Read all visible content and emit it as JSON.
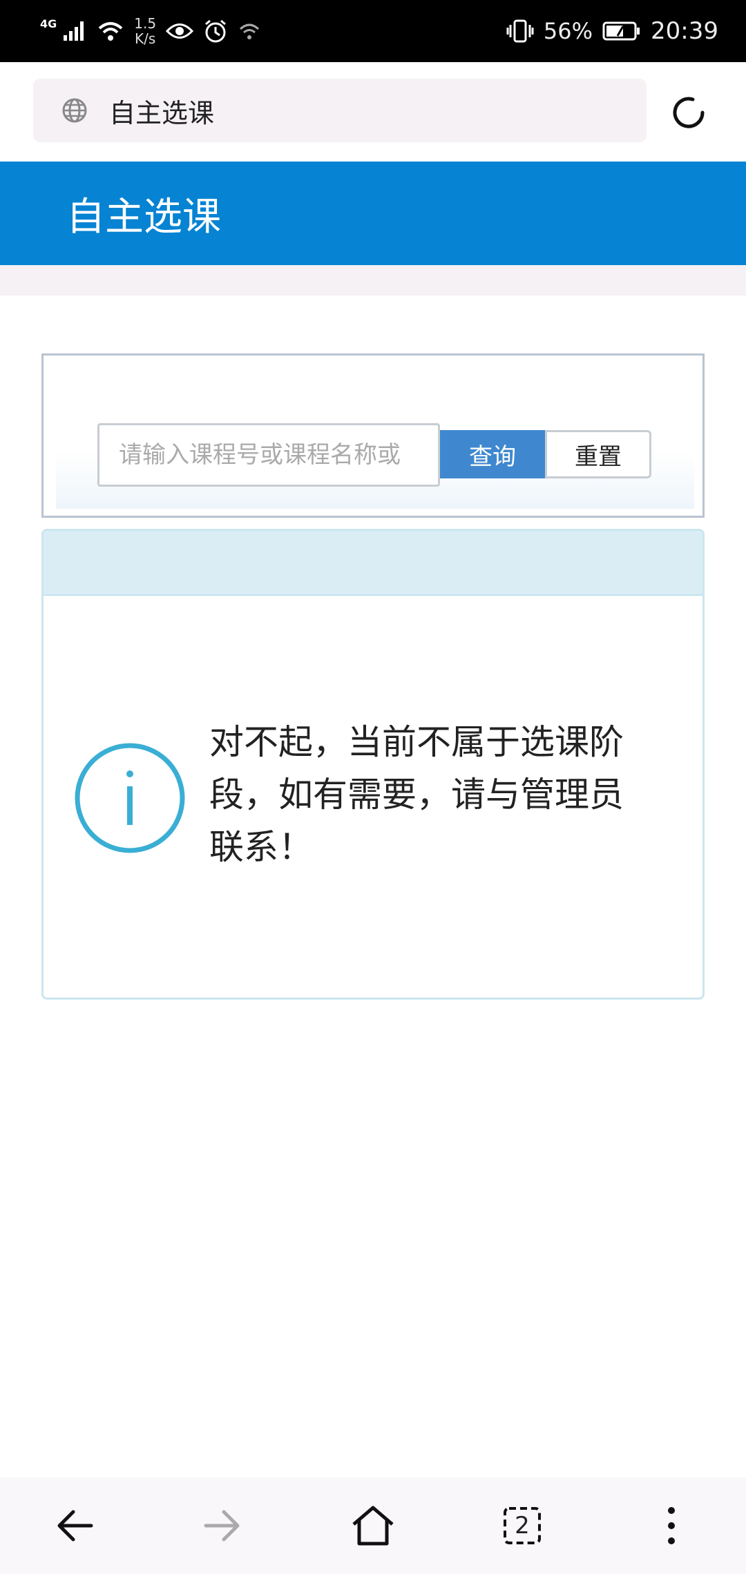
{
  "status_bar": {
    "network": "4G",
    "speed_value": "1.5",
    "speed_unit": "K/s",
    "battery": "56%",
    "time": "20:39"
  },
  "browser": {
    "url_text": "自主选课",
    "tab_count": "2"
  },
  "page": {
    "title": "自主选课"
  },
  "search": {
    "placeholder": "请输入课程号或课程名称或",
    "query_label": "查询",
    "reset_label": "重置"
  },
  "notice": {
    "message": "对不起，当前不属于选课阶段，如有需要，请与管理员联系！"
  },
  "colors": {
    "header": "#0683d3",
    "query_button": "#3f88cf",
    "info_icon": "#3aaed4"
  }
}
